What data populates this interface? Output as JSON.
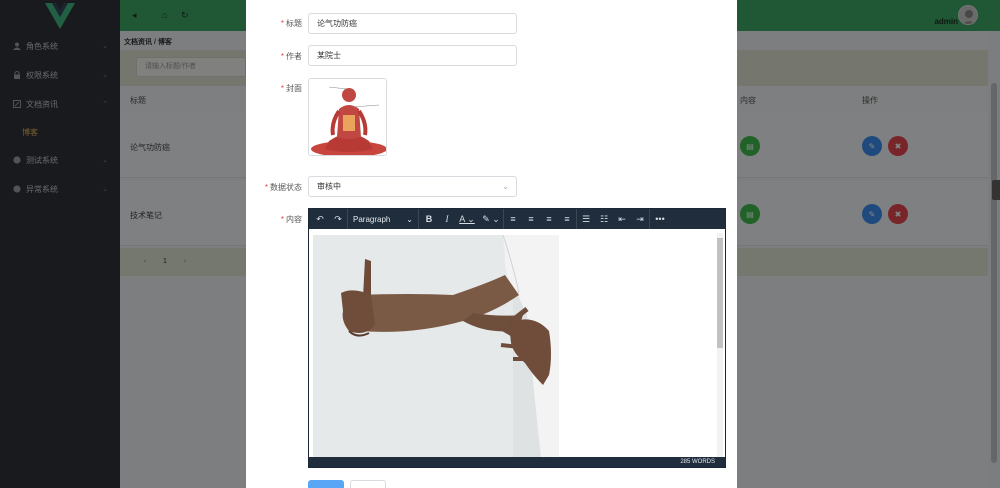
{
  "sidebar": {
    "items": [
      {
        "label": "角色系统"
      },
      {
        "label": "权限系统"
      },
      {
        "label": "文档资讯"
      },
      {
        "label": "博客"
      },
      {
        "label": "测试系统"
      },
      {
        "label": "异常系统"
      }
    ]
  },
  "header": {
    "user": "admin"
  },
  "breadcrumb": "文档资讯 / 博客",
  "search": {
    "placeholder": "请输入标题/作者"
  },
  "table": {
    "headers": [
      "标题",
      "内容",
      "操作"
    ],
    "rows": [
      {
        "title": "论气功防癌"
      },
      {
        "title": "技术笔记"
      }
    ]
  },
  "pager": {
    "prev": "‹",
    "page": "1",
    "next": "›"
  },
  "dialog": {
    "title_label": "标题",
    "title_value": "论气功防癌",
    "author_label": "作者",
    "author_value": "某院士",
    "cover_label": "封面",
    "status_label": "数据状态",
    "status_value": "审核中",
    "content_label": "内容",
    "required_mark": "*"
  },
  "editor": {
    "paragraph_label": "Paragraph",
    "word_count": "285 WORDS"
  },
  "colors": {
    "accent_green": "#3eaa68",
    "edit_blue": "#3d8ff0",
    "delete_red": "#e5484d",
    "view_green": "#3ebc4c"
  }
}
